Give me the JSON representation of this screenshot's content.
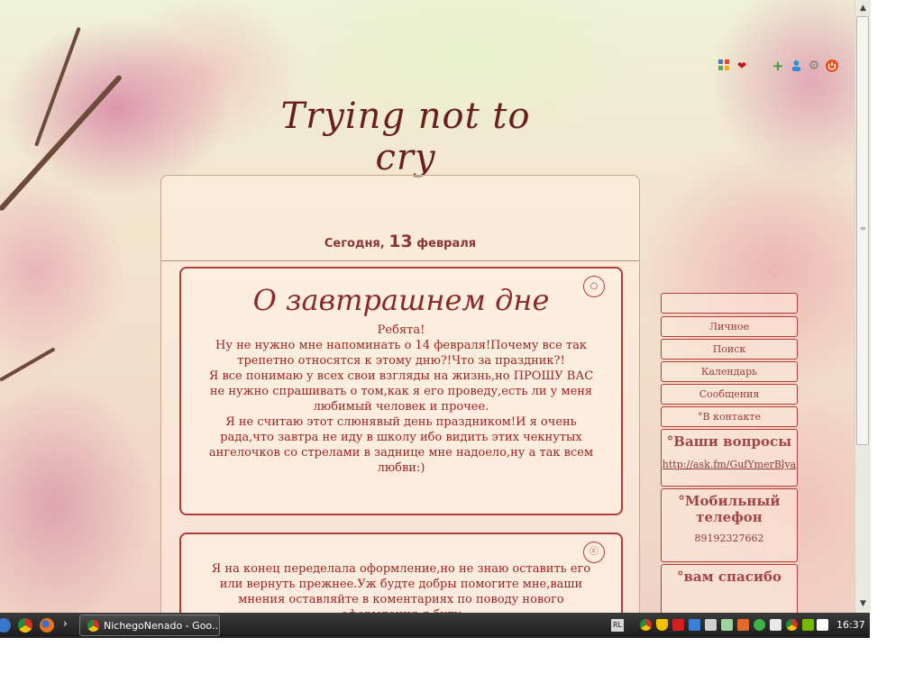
{
  "site": {
    "title": "Trying not to cry",
    "date_prefix": "Сегодня,",
    "date_day": "13",
    "date_month": "февраля"
  },
  "toolbar_icons": [
    "widgets-icon",
    "heart-icon",
    "add-icon",
    "user-icon",
    "settings-icon",
    "power-icon"
  ],
  "posts": [
    {
      "title": "О завтрашнем дне",
      "body": [
        "Ребята!",
        "Ну не нужно мне напоминать о 14 февраля!Почему все так трепетно относятся к этому дню?!Что за праздник?!",
        "Я все понимаю у всех свои взгляды на жизнь,но ПРОШУ ВАС не нужно спрашивать о том,как я его проведу,есть ли у меня любимый человек и прочее.",
        "Я не считаю этот слюнявый день праздником!И я очень рада,что завтра не иду в школу ибо видить этих чекнутых ангелочков со стрелами в заднице мне надоело,ну а так всем любви:)"
      ]
    },
    {
      "title": "",
      "body": [
        "Я на конец переделала оформление,но не знаю оставить его или вернуть прежнее.Уж будте добры помогите мне,ваши мнения оставляйте в коментариях по поводу нового оформления,я буду"
      ]
    }
  ],
  "sidebar": {
    "items": [
      "",
      "Личное",
      "Поиск",
      "Календарь",
      "Сообщения",
      "°В контакте"
    ],
    "ask_title": "°Ваши вопросы",
    "ask_link": "http://ask.fm/GufYmerBlya",
    "phone_title": "°Мобильный телефон",
    "phone_number": "89192327662",
    "thanks_title": "°вам спасибо"
  },
  "taskbar": {
    "window_title": "NichegoNenado - Goo...",
    "lang": "RL",
    "clock": "16:37"
  }
}
